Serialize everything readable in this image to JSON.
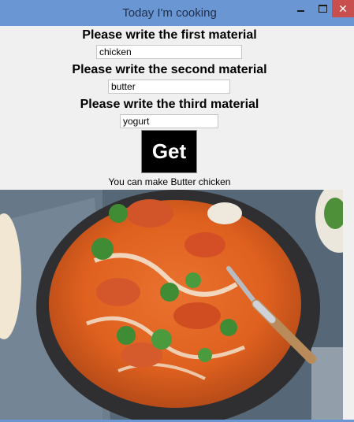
{
  "window": {
    "title": "Today I'm cooking",
    "controls": {
      "minimize": "minimize",
      "maximize": "maximize",
      "close": "✕"
    },
    "accent": "#6a96d3",
    "close_color": "#c94f4f"
  },
  "form": {
    "first_label": "Please write the first material",
    "first_value": "chicken",
    "second_label": "Please write the second material",
    "second_value": "butter",
    "third_label": "Please write the third material",
    "third_value": "yogurt",
    "button_label": "Get",
    "result_text": "You can make Butter chicken"
  },
  "image": {
    "icon": "butter-chicken-photo"
  }
}
